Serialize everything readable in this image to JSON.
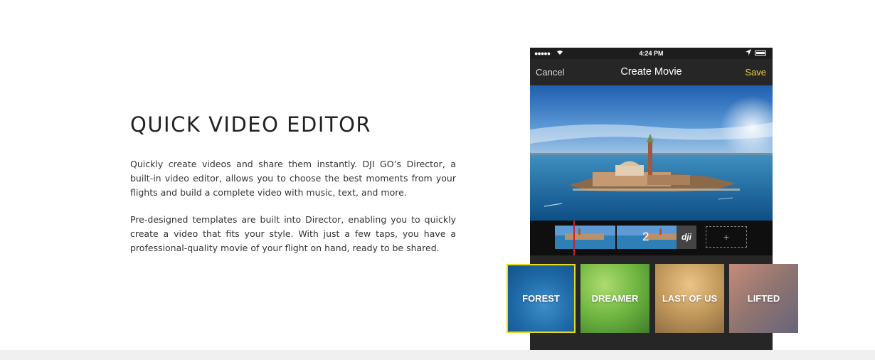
{
  "feature": {
    "title": "QUICK VIDEO EDITOR",
    "paragraphs": [
      "Quickly create videos and share them instantly. DJI GO’s Director, a built-in video editor, allows you to choose the best moments from your flights and build a complete video with music, text, and more.",
      "Pre-designed templates are built into Director, enabling you to quickly create a video that fits your style. With just a few taps, you have a professional-quality movie of your flight on hand, ready to be shared."
    ]
  },
  "phone": {
    "status_bar": {
      "signal": "●●●●●",
      "time": "4:24 PM"
    },
    "nav": {
      "cancel": "Cancel",
      "title": "Create Movie",
      "save": "Save"
    },
    "timeline": {
      "clip2_number": "2",
      "add_label": "+",
      "brand": "dji"
    }
  },
  "templates": [
    {
      "label": "FOREST",
      "selected": true
    },
    {
      "label": "DREAMER"
    },
    {
      "label": "LAST OF US"
    },
    {
      "label": "LIFTED"
    }
  ],
  "colors": {
    "accent_yellow": "#e8dc1c",
    "save_yellow": "#e7d33a",
    "playhead_red": "#d01f24",
    "phone_dark": "#262626"
  }
}
